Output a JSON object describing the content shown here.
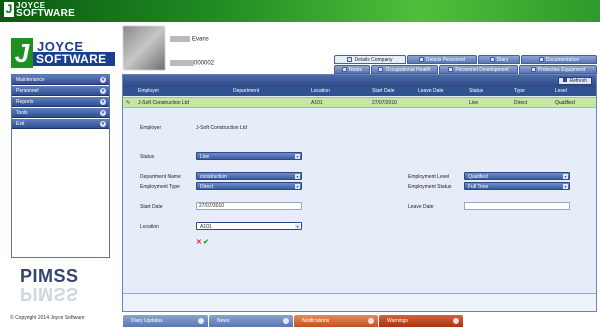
{
  "banner": {
    "logo_line1": "JOYCE",
    "logo_line2": "SOFTWARE",
    "logo_mark": "J"
  },
  "brand": {
    "logo_mark": "J",
    "logo_line1": "JOYCE",
    "logo_line2": "SOFTWARE",
    "product": "PIMSS",
    "copyright": "© Copyright 2014 Joyce Software"
  },
  "sidebar": {
    "items": [
      {
        "label": "Maintenance",
        "icon": "chevron-down-icon"
      },
      {
        "label": "Personnel",
        "icon": "chevron-down-icon"
      },
      {
        "label": "Reports",
        "icon": "chevron-down-icon"
      },
      {
        "label": "Tools",
        "icon": "chevron-down-icon"
      },
      {
        "label": "Exit",
        "icon": "chevron-down-icon"
      }
    ]
  },
  "employee": {
    "surname": "Evans",
    "number": "000002"
  },
  "tabs": {
    "row1": [
      "Details Company",
      "Details Personnel",
      "Diary",
      "Documentation"
    ],
    "row2": [
      "Notes",
      "Occupational Health",
      "Personnel Development",
      "Protective Equipment"
    ],
    "active": "Details Company"
  },
  "toolbar": {
    "refresh_label": "Refresh"
  },
  "grid": {
    "columns": [
      "Employer",
      "Department",
      "Location",
      "Start Date",
      "Leave Date",
      "Status",
      "Type",
      "Level"
    ],
    "rows": [
      [
        "J-Soft Construction Ltd",
        "",
        "A101",
        "27/07/2010",
        "",
        "Live",
        "Direct",
        "Qualified"
      ]
    ]
  },
  "form": {
    "employer_label": "Employer",
    "employer_value": "J-Soft Construction Ltd",
    "status_label": "Status",
    "status_value": "Live",
    "department_label": "Department Name",
    "department_value": "construction",
    "employment_type_label": "Employment Type",
    "employment_type_value": "Direct",
    "employment_level_label": "Employment Level",
    "employment_level_value": "Qualified",
    "employment_status_label": "Employment Status",
    "employment_status_value": "Full Time",
    "start_date_label": "Start Date",
    "start_date_value": "27/07/2010",
    "leave_date_label": "Leave Date",
    "leave_date_value": "",
    "location_label": "Location",
    "location_value": "A101",
    "cancel_symbol": "✕",
    "save_symbol": "✔"
  },
  "bottom_tabs": [
    {
      "label": "Diary Updates",
      "color": "#5a76b4"
    },
    {
      "label": "News",
      "color": "#5a76b4"
    },
    {
      "label": "Notifications",
      "color": "#c1521f"
    },
    {
      "label": "Warnings",
      "color": "#a5360f"
    }
  ]
}
